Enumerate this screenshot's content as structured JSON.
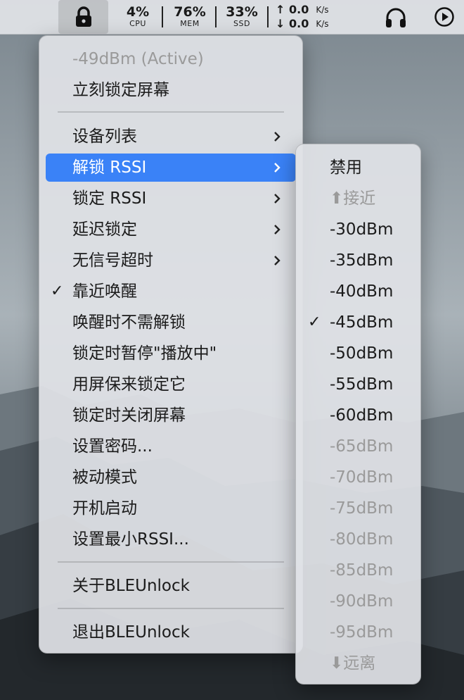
{
  "menubar": {
    "cpu": {
      "value": "4%",
      "label": "CPU"
    },
    "mem": {
      "value": "76%",
      "label": "MEM"
    },
    "ssd": {
      "value": "33%",
      "label": "SSD"
    },
    "net_up": "↑ 0.0",
    "net_down": "↓ 0.0",
    "net_unit": "K/s"
  },
  "main_menu": {
    "status": "-49dBm (Active)",
    "lock_now": "立刻锁定屏幕",
    "device_list": "设备列表",
    "unlock_rssi": "解锁 RSSI",
    "lock_rssi": "锁定 RSSI",
    "lock_delay": "延迟锁定",
    "no_signal_timeout": "无信号超时",
    "wake_on_proximity": "靠近唤醒",
    "wake_without_unlock": "唤醒时不需解锁",
    "pause_now_playing": "锁定时暂停\"播放中\"",
    "use_screensaver": "用屏保来锁定它",
    "turn_off_screen": "锁定时关闭屏幕",
    "set_password": "设置密码...",
    "passive_mode": "被动模式",
    "launch_at_login": "开机启动",
    "set_min_rssi": "设置最小RSSI...",
    "about": "关于BLEUnlock",
    "quit": "退出BLEUnlock"
  },
  "sub_menu": {
    "items": [
      "禁用",
      "⬆接近",
      "-30dBm",
      "-35dBm",
      "-40dBm",
      "-45dBm",
      "-50dBm",
      "-55dBm",
      "-60dBm",
      "-65dBm",
      "-70dBm",
      "-75dBm",
      "-80dBm",
      "-85dBm",
      "-90dBm",
      "-95dBm",
      "⬇远离"
    ]
  }
}
